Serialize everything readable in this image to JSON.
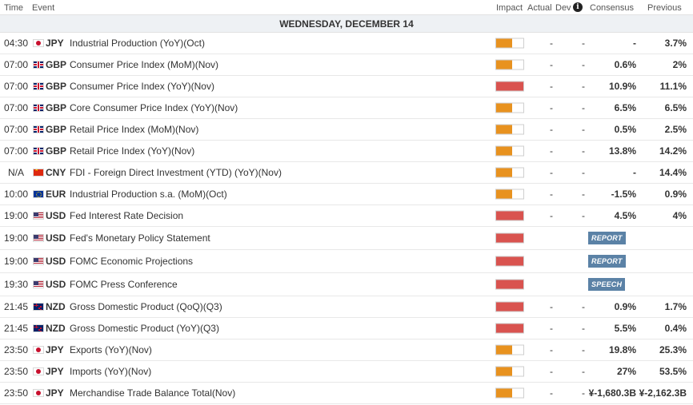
{
  "header": {
    "time": "Time",
    "event": "Event",
    "impact": "Impact",
    "actual": "Actual",
    "dev": "Dev",
    "consensus": "Consensus",
    "previous": "Previous"
  },
  "day_label": "WEDNESDAY, DECEMBER 14",
  "colors": {
    "high_impact": "#d9534f",
    "medium_impact": "#e8921f",
    "tag": "#5b82a6",
    "day_band": "#eef1f4"
  },
  "events": [
    {
      "time": "04:30",
      "flag": "japan-flag-icon",
      "currency": "JPY",
      "event": "Industrial Production (YoY)(Oct)",
      "impact": "medium",
      "actual": "-",
      "dev": "-",
      "consensus": "-",
      "previous": "3.7%"
    },
    {
      "time": "07:00",
      "flag": "uk-flag-icon",
      "currency": "GBP",
      "event": "Consumer Price Index (MoM)(Nov)",
      "impact": "medium",
      "actual": "-",
      "dev": "-",
      "consensus": "0.6%",
      "previous": "2%"
    },
    {
      "time": "07:00",
      "flag": "uk-flag-icon",
      "currency": "GBP",
      "event": "Consumer Price Index (YoY)(Nov)",
      "impact": "high",
      "actual": "-",
      "dev": "-",
      "consensus": "10.9%",
      "previous": "11.1%"
    },
    {
      "time": "07:00",
      "flag": "uk-flag-icon",
      "currency": "GBP",
      "event": "Core Consumer Price Index (YoY)(Nov)",
      "impact": "medium",
      "actual": "-",
      "dev": "-",
      "consensus": "6.5%",
      "previous": "6.5%"
    },
    {
      "time": "07:00",
      "flag": "uk-flag-icon",
      "currency": "GBP",
      "event": "Retail Price Index (MoM)(Nov)",
      "impact": "medium",
      "actual": "-",
      "dev": "-",
      "consensus": "0.5%",
      "previous": "2.5%"
    },
    {
      "time": "07:00",
      "flag": "uk-flag-icon",
      "currency": "GBP",
      "event": "Retail Price Index (YoY)(Nov)",
      "impact": "medium",
      "actual": "-",
      "dev": "-",
      "consensus": "13.8%",
      "previous": "14.2%"
    },
    {
      "time": "N/A",
      "flag": "china-flag-icon",
      "currency": "CNY",
      "event": "FDI - Foreign Direct Investment (YTD) (YoY)(Nov)",
      "impact": "medium",
      "actual": "-",
      "dev": "-",
      "consensus": "-",
      "previous": "14.4%"
    },
    {
      "time": "10:00",
      "flag": "eu-flag-icon",
      "currency": "EUR",
      "event": "Industrial Production s.a. (MoM)(Oct)",
      "impact": "medium",
      "actual": "-",
      "dev": "-",
      "consensus": "-1.5%",
      "previous": "0.9%"
    },
    {
      "time": "19:00",
      "flag": "us-flag-icon",
      "currency": "USD",
      "event": "Fed Interest Rate Decision",
      "impact": "high",
      "actual": "-",
      "dev": "-",
      "consensus": "4.5%",
      "previous": "4%"
    },
    {
      "time": "19:00",
      "flag": "us-flag-icon",
      "currency": "USD",
      "event": "Fed's Monetary Policy Statement",
      "impact": "high",
      "tag": "REPORT"
    },
    {
      "time": "19:00",
      "flag": "us-flag-icon",
      "currency": "USD",
      "event": "FOMC Economic Projections",
      "impact": "high",
      "tag": "REPORT"
    },
    {
      "time": "19:30",
      "flag": "us-flag-icon",
      "currency": "USD",
      "event": "FOMC Press Conference",
      "impact": "high",
      "tag": "SPEECH"
    },
    {
      "time": "21:45",
      "flag": "new-zealand-flag-icon",
      "currency": "NZD",
      "event": "Gross Domestic Product (QoQ)(Q3)",
      "impact": "high",
      "actual": "-",
      "dev": "-",
      "consensus": "0.9%",
      "previous": "1.7%"
    },
    {
      "time": "21:45",
      "flag": "new-zealand-flag-icon",
      "currency": "NZD",
      "event": "Gross Domestic Product (YoY)(Q3)",
      "impact": "high",
      "actual": "-",
      "dev": "-",
      "consensus": "5.5%",
      "previous": "0.4%"
    },
    {
      "time": "23:50",
      "flag": "japan-flag-icon",
      "currency": "JPY",
      "event": "Exports (YoY)(Nov)",
      "impact": "medium",
      "actual": "-",
      "dev": "-",
      "consensus": "19.8%",
      "previous": "25.3%"
    },
    {
      "time": "23:50",
      "flag": "japan-flag-icon",
      "currency": "JPY",
      "event": "Imports (YoY)(Nov)",
      "impact": "medium",
      "actual": "-",
      "dev": "-",
      "consensus": "27%",
      "previous": "53.5%"
    },
    {
      "time": "23:50",
      "flag": "japan-flag-icon",
      "currency": "JPY",
      "event": "Merchandise Trade Balance Total(Nov)",
      "impact": "medium",
      "actual": "-",
      "dev": "-",
      "consensus": "¥-1,680.3B",
      "previous": "¥-2,162.3B"
    }
  ]
}
